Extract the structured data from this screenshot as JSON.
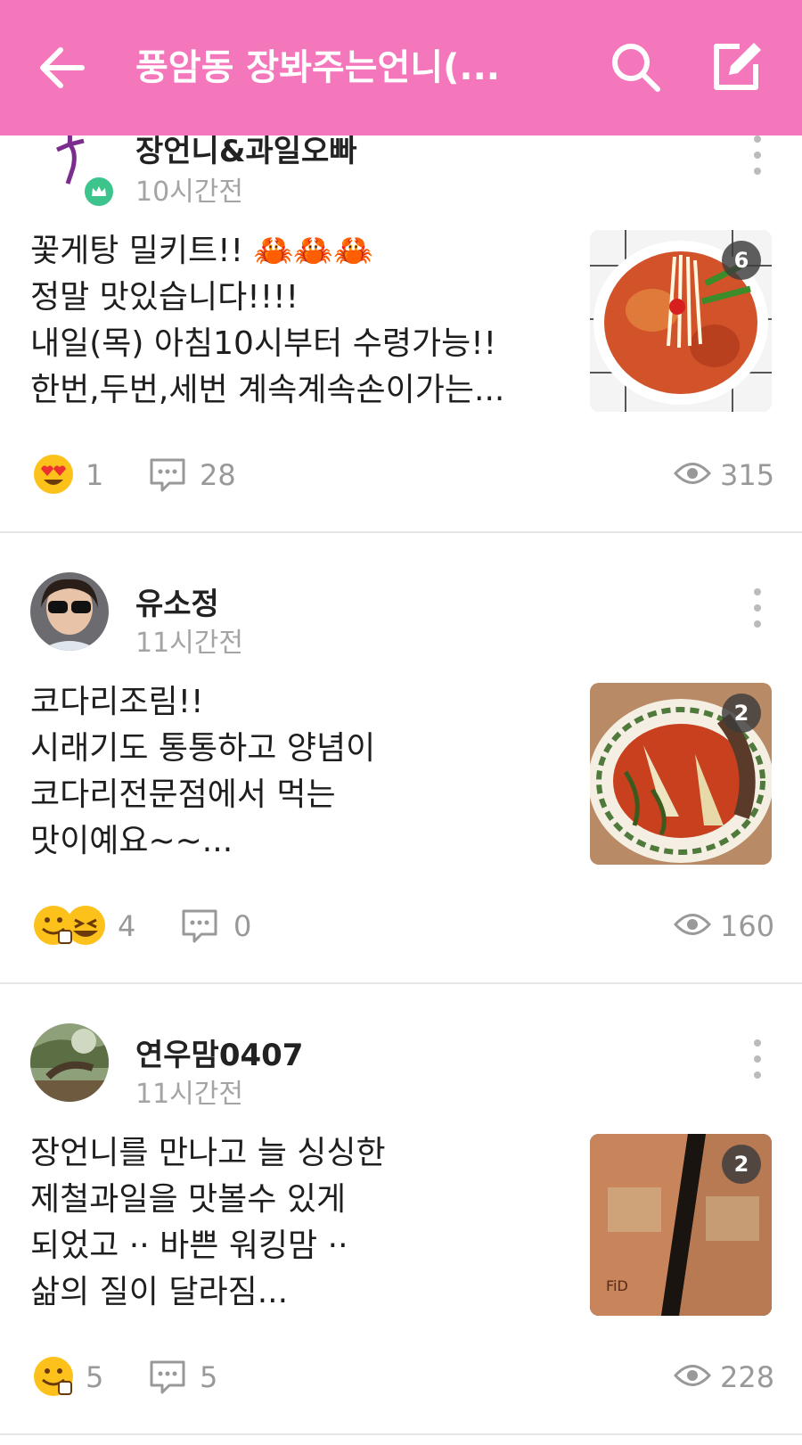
{
  "header": {
    "title": "풍암동 장봐주는언니(...",
    "bg_color": "#f577bb"
  },
  "posts": [
    {
      "author": "장언니&과일오빠",
      "time": "10시간전",
      "avatar": "logo-avatar",
      "lines": [
        "꽃게탕 밀키트!! 🦀🦀🦀",
        "정말 맛있습니다!!!!",
        "내일(목) 아침10시부터 수령가능!!",
        "한번,두번,세번 계속계속손이가는..."
      ],
      "photo_count": "6",
      "reaction_count": "1",
      "comment_count": "28",
      "view_count": "315"
    },
    {
      "author": "유소정",
      "time": "11시간전",
      "avatar": "photo-avatar",
      "lines": [
        "코다리조림!!",
        "시래기도 통통하고 양념이",
        "코다리전문점에서 먹는",
        "맛이예요~~..."
      ],
      "photo_count": "2",
      "reaction_count": "4",
      "comment_count": "0",
      "view_count": "160"
    },
    {
      "author": "연우맘0407",
      "time": "11시간전",
      "avatar": "tree-avatar",
      "lines": [
        "장언니를 만나고 늘 싱싱한",
        "제철과일을 맛볼수 있게",
        "되었고 ·· 바쁜 워킹맘 ··",
        "삶의 질이 달라짐..."
      ],
      "photo_count": "2",
      "reaction_count": "5",
      "comment_count": "5",
      "view_count": "228"
    }
  ]
}
